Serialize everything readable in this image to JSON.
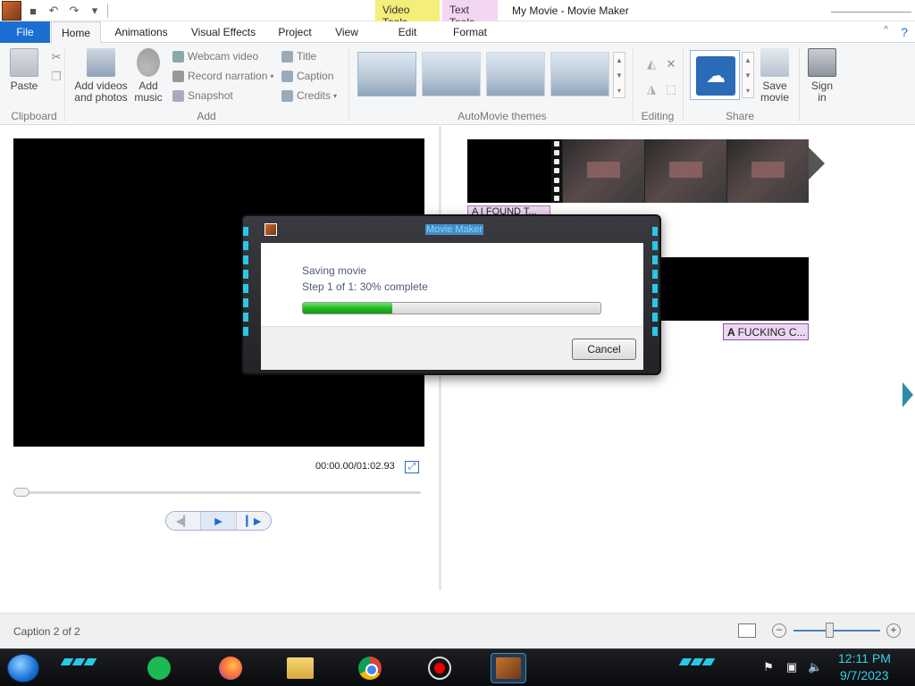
{
  "window": {
    "title": "My Movie - Movie Maker",
    "context_tabs": {
      "video_tools": "Video Tools",
      "text_tools": "Text Tools"
    }
  },
  "tabs": {
    "file": "File",
    "home": "Home",
    "animations": "Animations",
    "visual_effects": "Visual Effects",
    "project": "Project",
    "view": "View",
    "edit": "Edit",
    "format": "Format"
  },
  "ribbon": {
    "clipboard": {
      "paste": "Paste",
      "label": "Clipboard"
    },
    "add": {
      "add_videos_line1": "Add videos",
      "add_videos_line2": "and photos",
      "add_music_line1": "Add",
      "add_music_line2": "music",
      "webcam": "Webcam video",
      "narration": "Record narration",
      "snapshot": "Snapshot",
      "title": "Title",
      "caption": "Caption",
      "credits": "Credits",
      "label": "Add"
    },
    "themes": {
      "label": "AutoMovie themes"
    },
    "editing": {
      "label": "Editing"
    },
    "share": {
      "save_movie_line1": "Save",
      "save_movie_line2": "movie",
      "sign_in_line1": "Sign",
      "sign_in_line2": "in",
      "label": "Share"
    }
  },
  "preview": {
    "timecode": "00:00.00/01:02.93"
  },
  "storyboard": {
    "caption1": "A I FOUND T...",
    "caption2": "FUCKING C..."
  },
  "status": {
    "text": "Caption 2 of 2"
  },
  "dialog": {
    "title": "Movie Maker",
    "heading": "Saving movie",
    "step": "Step 1 of 1: 30% complete",
    "progress": 0.3,
    "cancel": "Cancel"
  },
  "taskbar": {
    "time": "12:11 PM",
    "date": "9/7/2023"
  },
  "colors": {
    "accent": "#1b6fd3",
    "progress_green": "#1fb41f",
    "clock": "#2fd4ec",
    "caption_bg": "#ecd6f0"
  }
}
